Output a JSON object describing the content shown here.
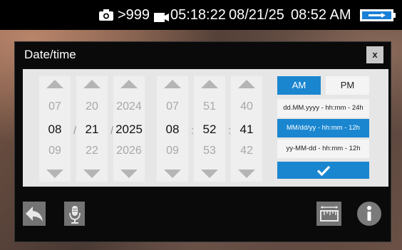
{
  "status_bar": {
    "camera_icon": "camera-icon",
    "photo_count": ">999",
    "recording_icon": "video-record-icon",
    "recording_time": "05:18:22",
    "date": "08/21/25",
    "clock": "08:52 AM",
    "battery_icon": "battery-charging-icon"
  },
  "dialog": {
    "title": "Date/time",
    "close_label": "x",
    "date_columns": [
      {
        "prev": "07",
        "current": "08",
        "next": "09"
      },
      {
        "prev": "20",
        "current": "21",
        "next": "22"
      },
      {
        "prev": "2024",
        "current": "2025",
        "next": "2026"
      }
    ],
    "time_columns": [
      {
        "prev": "07",
        "current": "08",
        "next": "09"
      },
      {
        "prev": "51",
        "current": "52",
        "next": "53"
      },
      {
        "prev": "40",
        "current": "41",
        "next": "42"
      }
    ],
    "date_separator": "/",
    "time_separator": ":",
    "am_label": "AM",
    "pm_label": "PM",
    "selected_period": "AM",
    "formats": [
      {
        "label": "dd.MM.yyyy - hh:mm - 24h",
        "selected": false
      },
      {
        "label": "MM/dd/yy - hh:mm - 12h",
        "selected": true
      },
      {
        "label": "yy-MM-dd - hh:mm - 12h",
        "selected": false
      }
    ],
    "accent_color": "#1a86d0"
  },
  "toolbar": {
    "left_icons": [
      "back-arrow-icon",
      "microphone-icon"
    ],
    "right_icons": [
      "ruler-icon",
      "info-icon"
    ]
  }
}
